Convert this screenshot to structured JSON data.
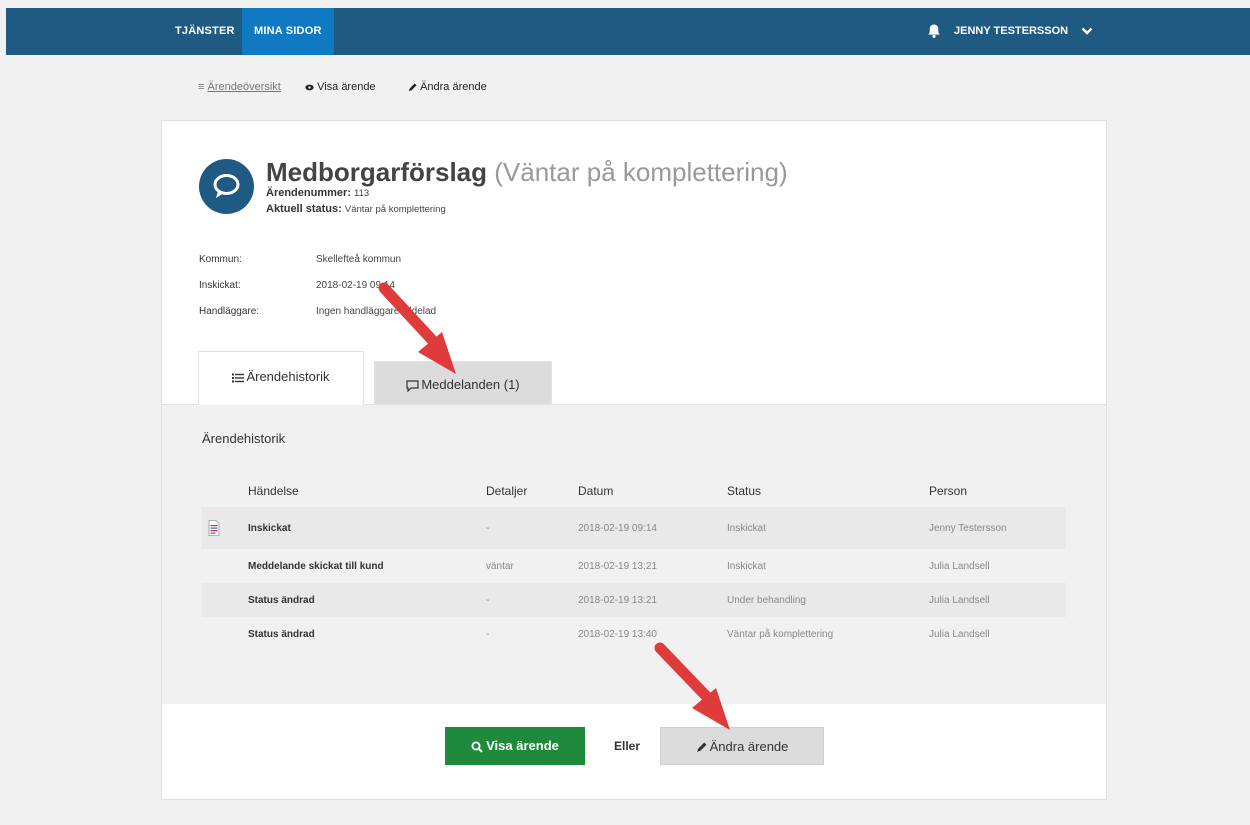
{
  "nav": {
    "tjanster": "TJÄNSTER",
    "mina_sidor": "MINA SIDOR",
    "user_name": "JENNY TESTERSSON"
  },
  "breadcrumb": {
    "overview": "Ärendeöversikt",
    "view": "Visa ärende",
    "edit": "Ändra ärende"
  },
  "case": {
    "title": "Medborgarförslag",
    "title_status": "(Väntar på komplettering)",
    "number_label": "Ärendenummer:",
    "number_value": "113",
    "status_label": "Aktuell status:",
    "status_value": "Väntar på komplettering"
  },
  "info": [
    {
      "label": "Kommun:",
      "value": "Skellefteå kommun"
    },
    {
      "label": "Inskickat:",
      "value": "2018-02-19 09:14"
    },
    {
      "label": "Handläggare:",
      "value": "Ingen handläggare tilldelad"
    }
  ],
  "tabs": {
    "history": "Ärendehistorik",
    "messages": "Meddelanden (1)"
  },
  "history": {
    "title": "Ärendehistorik",
    "columns": [
      "Händelse",
      "Detaljer",
      "Datum",
      "Status",
      "Person"
    ],
    "rows": [
      {
        "event": "Inskickat",
        "details": "-",
        "date": "2018-02-19 09:14",
        "status": "Inskickat",
        "person": "Jenny Testersson"
      },
      {
        "event": "Meddelande skickat till kund",
        "details": "väntar",
        "date": "2018-02-19 13:21",
        "status": "Inskickat",
        "person": "Julia Landsell"
      },
      {
        "event": "Status ändrad",
        "details": "-",
        "date": "2018-02-19 13:21",
        "status": "Under behandling",
        "person": "Julia Landsell"
      },
      {
        "event": "Status ändrad",
        "details": "-",
        "date": "2018-02-19 13:40",
        "status": "Väntar på komplettering",
        "person": "Julia Landsell"
      }
    ]
  },
  "actions": {
    "view": "Visa ärende",
    "or": "Eller",
    "edit": "Ändra ärende"
  },
  "colors": {
    "nav_bg": "#1e5a82",
    "nav_active": "#0f79c2",
    "primary_button": "#1f8a3b",
    "annotation_arrow": "#e03b3b"
  },
  "icons": [
    "bell-icon",
    "chevron-down-icon",
    "eye-icon",
    "pencil-icon",
    "speech-bubble-icon",
    "list-icon",
    "comment-icon",
    "document-icon",
    "search-icon"
  ]
}
